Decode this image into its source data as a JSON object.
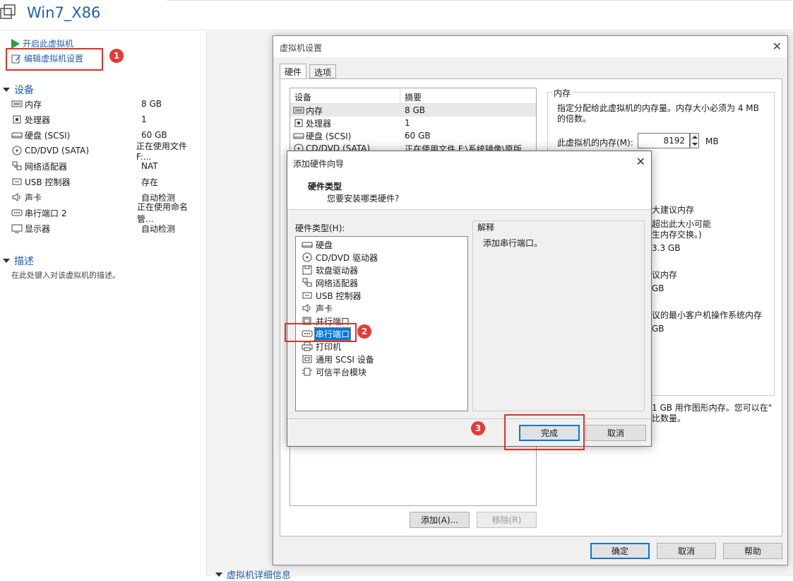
{
  "window": {
    "title": "Win7_X86"
  },
  "actions": {
    "power_on": "开启此虚拟机",
    "edit_settings": "编辑虚拟机设置"
  },
  "devices_section": {
    "title": "设备",
    "items": [
      {
        "icon": "memory-icon",
        "name": "内存",
        "value": "8 GB"
      },
      {
        "icon": "cpu-icon",
        "name": "处理器",
        "value": "1"
      },
      {
        "icon": "disk-icon",
        "name": "硬盘 (SCSI)",
        "value": "60 GB"
      },
      {
        "icon": "cd-icon",
        "name": "CD/DVD (SATA)",
        "value": "正在使用文件 F:..."
      },
      {
        "icon": "network-icon",
        "name": "网络适配器",
        "value": "NAT"
      },
      {
        "icon": "usb-icon",
        "name": "USB 控制器",
        "value": "存在"
      },
      {
        "icon": "sound-icon",
        "name": "声卡",
        "value": "自动检测"
      },
      {
        "icon": "serial-icon",
        "name": "串行端口 2",
        "value": "正在使用命名管..."
      },
      {
        "icon": "display-icon",
        "name": "显示器",
        "value": "自动检测"
      }
    ]
  },
  "description_section": {
    "title": "描述",
    "placeholder": "在此处键入对该虚拟机的描述。"
  },
  "bottom_section": {
    "title": "虚拟机详细信息"
  },
  "badges": [
    "1",
    "2",
    "3"
  ],
  "settings_dialog": {
    "title": "虚拟机设置",
    "tabs": [
      "硬件",
      "选项"
    ],
    "table_headers": [
      "设备",
      "摘要"
    ],
    "rows": [
      {
        "icon": "memory-icon",
        "device": "内存",
        "summary": "8 GB"
      },
      {
        "icon": "cpu-icon",
        "device": "处理器",
        "summary": "1"
      },
      {
        "icon": "disk-icon",
        "device": "硬盘 (SCSI)",
        "summary": "60 GB"
      },
      {
        "icon": "cd-icon",
        "device": "CD/DVD (SATA)",
        "summary": "正在使用文件 F:\\系统镜像\\原版..."
      }
    ],
    "memory_group": {
      "legend": "内存",
      "desc_line1": "指定分配给此虚拟机的内存量。内存大小必须为 4 MB",
      "desc_line2": "的倍数。",
      "label": "此虚拟机的内存(M):",
      "value": "8192",
      "unit": "MB",
      "partial_lines": [
        "大建议内存",
        "超出此大小可能",
        "生内存交换。)",
        "3.3 GB",
        "议内存",
        "GB",
        "议的最小客户机操作系统内存",
        "GB"
      ],
      "partial_footer1": "1 GB 用作图形内存。您可以在\"",
      "partial_footer2": "比数量。"
    },
    "add_button": "添加(A)...",
    "remove_button": "移除(R)",
    "ok_button": "确定",
    "cancel_button": "取消",
    "help_button": "帮助"
  },
  "wizard": {
    "title": "添加硬件向导",
    "heading": "硬件类型",
    "subheading": "您要安装哪类硬件?",
    "list_label": "硬件类型(H):",
    "items": [
      {
        "icon": "disk-icon",
        "label": "硬盘"
      },
      {
        "icon": "cd-icon",
        "label": "CD/DVD 驱动器"
      },
      {
        "icon": "floppy-icon",
        "label": "软盘驱动器"
      },
      {
        "icon": "network-icon",
        "label": "网络适配器"
      },
      {
        "icon": "usb-icon",
        "label": "USB 控制器"
      },
      {
        "icon": "sound-icon",
        "label": "声卡"
      },
      {
        "icon": "parallel-icon",
        "label": "并行端口"
      },
      {
        "icon": "serial-icon",
        "label": "串行端口"
      },
      {
        "icon": "printer-icon",
        "label": "打印机"
      },
      {
        "icon": "scsi-icon",
        "label": "通用 SCSI 设备"
      },
      {
        "icon": "tpm-icon",
        "label": "可信平台模块"
      }
    ],
    "selected_index": 7,
    "explain_label": "解释",
    "explain_text": "添加串行端口。",
    "finish_button": "完成",
    "cancel_button": "取消"
  },
  "colors": {
    "accent": "#0078d7",
    "link": "#1e5fb3",
    "highlight": "#e0302a"
  }
}
